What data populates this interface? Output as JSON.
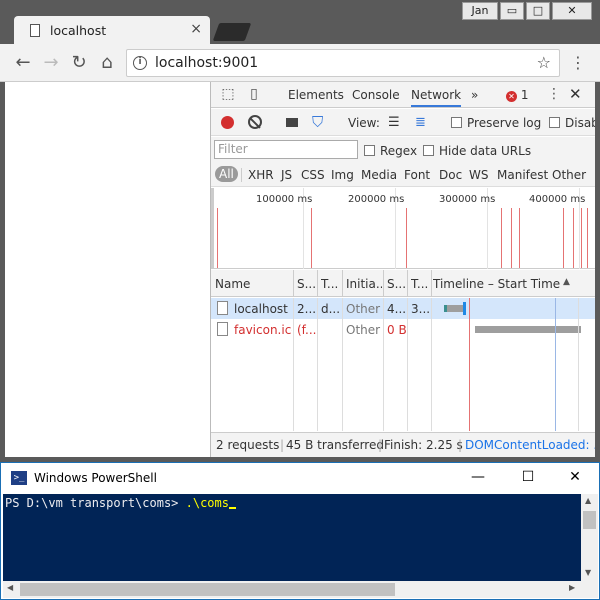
{
  "browser": {
    "tab_title": "localhost",
    "tab_close": "×",
    "user": "Jan",
    "min": "▭",
    "max": "□",
    "close": "✕",
    "url": "localhost:9001",
    "info_icon": "i",
    "star": "☆",
    "menu": "⋮",
    "back": "←",
    "forward": "→",
    "reload": "↻",
    "home": "⌂"
  },
  "devtools": {
    "tabs": [
      "Elements",
      "Console",
      "Network"
    ],
    "more": "»",
    "error_count": "1",
    "error_icon": "✕",
    "menu": "⋮",
    "close": "✕",
    "view_label": "View:",
    "preserve_log": "Preserve log",
    "disable_cache": "Disab",
    "filter_placeholder": "Filter",
    "regex": "Regex",
    "hide_data_urls": "Hide data URLs",
    "types": [
      "All",
      "XHR",
      "JS",
      "CSS",
      "Img",
      "Media",
      "Font",
      "Doc",
      "WS",
      "Manifest",
      "Other"
    ],
    "overview_labels": [
      "100000 ms",
      "200000 ms",
      "300000 ms",
      "400000 ms"
    ],
    "columns": [
      "Name",
      "S...",
      "T...",
      "Initia...",
      "S...",
      "T...",
      "Timeline – Start Time"
    ],
    "sort_arrow": "▲",
    "requests": [
      {
        "name": "localhost",
        "status": "2...",
        "type": "d...",
        "initiator": "Other",
        "size": "4...",
        "time": "3...",
        "error": false
      },
      {
        "name": "favicon.ico",
        "status": "(f...",
        "type": "",
        "initiator": "Other",
        "size": "0 B",
        "time": "",
        "error": true
      }
    ],
    "status": {
      "requests": "2 requests",
      "transferred": "45 B transferred",
      "finish": "Finish: 2.25 s",
      "dcl": "DOMContentLoaded: ..."
    }
  },
  "powershell": {
    "title": "Windows PowerShell",
    "icon": ">_",
    "min": "—",
    "max": "☐",
    "close": "✕",
    "prompt": "PS D:\\vm transport\\coms> ",
    "command": ".\\coms",
    "up": "▲",
    "down": "▼",
    "left": "◀",
    "right": "▶"
  }
}
